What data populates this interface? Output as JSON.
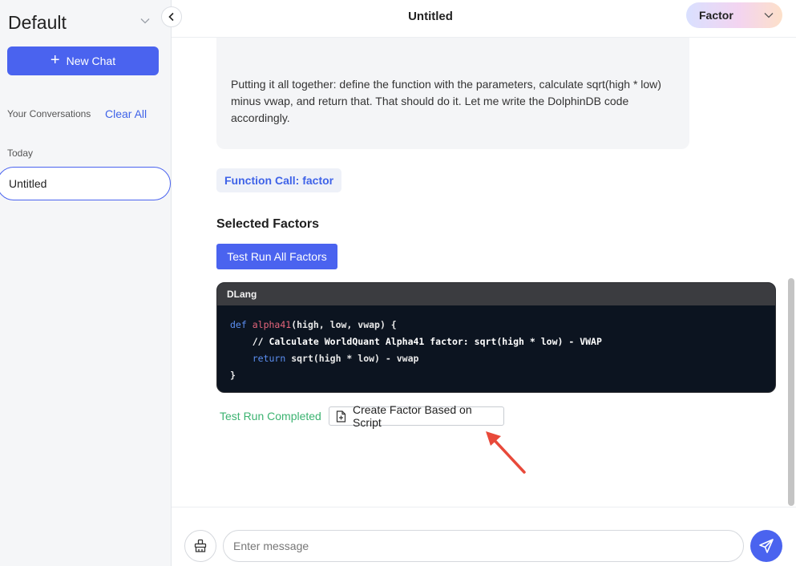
{
  "sidebar": {
    "workspace_title": "Default",
    "new_chat_label": "New Chat",
    "conversations_label": "Your Conversations",
    "clear_all_label": "Clear All",
    "today_label": "Today",
    "conversations": [
      {
        "title": "Untitled"
      }
    ]
  },
  "header": {
    "title": "Untitled",
    "mode": "Factor"
  },
  "chat": {
    "thinking_text": "Putting it all together: define the function with the parameters, calculate sqrt(high * low) minus vwap, and return that. That should do it. Let me write the DolphinDB code accordingly.",
    "function_call_label": "Function Call: factor",
    "selected_factors_title": "Selected Factors",
    "test_run_all_label": "Test Run All Factors",
    "code": {
      "language": "DLang",
      "keyword_def": "def",
      "function_name": "alpha41",
      "params": "(high, low, vwap) {",
      "comment": "// Calculate WorldQuant Alpha41 factor: sqrt(high * low) - VWAP",
      "keyword_return": "return",
      "return_expr": "sqrt(high * low) - vwap",
      "closing": "}"
    },
    "run_status": "Test Run Completed",
    "create_factor_label": "Create Factor Based on Script"
  },
  "footer": {
    "input_placeholder": "Enter message",
    "input_value": ""
  },
  "colors": {
    "accent": "#4a63ef",
    "link": "#3f63e8",
    "success": "#3cb371",
    "annotation_arrow": "#e8493a"
  }
}
